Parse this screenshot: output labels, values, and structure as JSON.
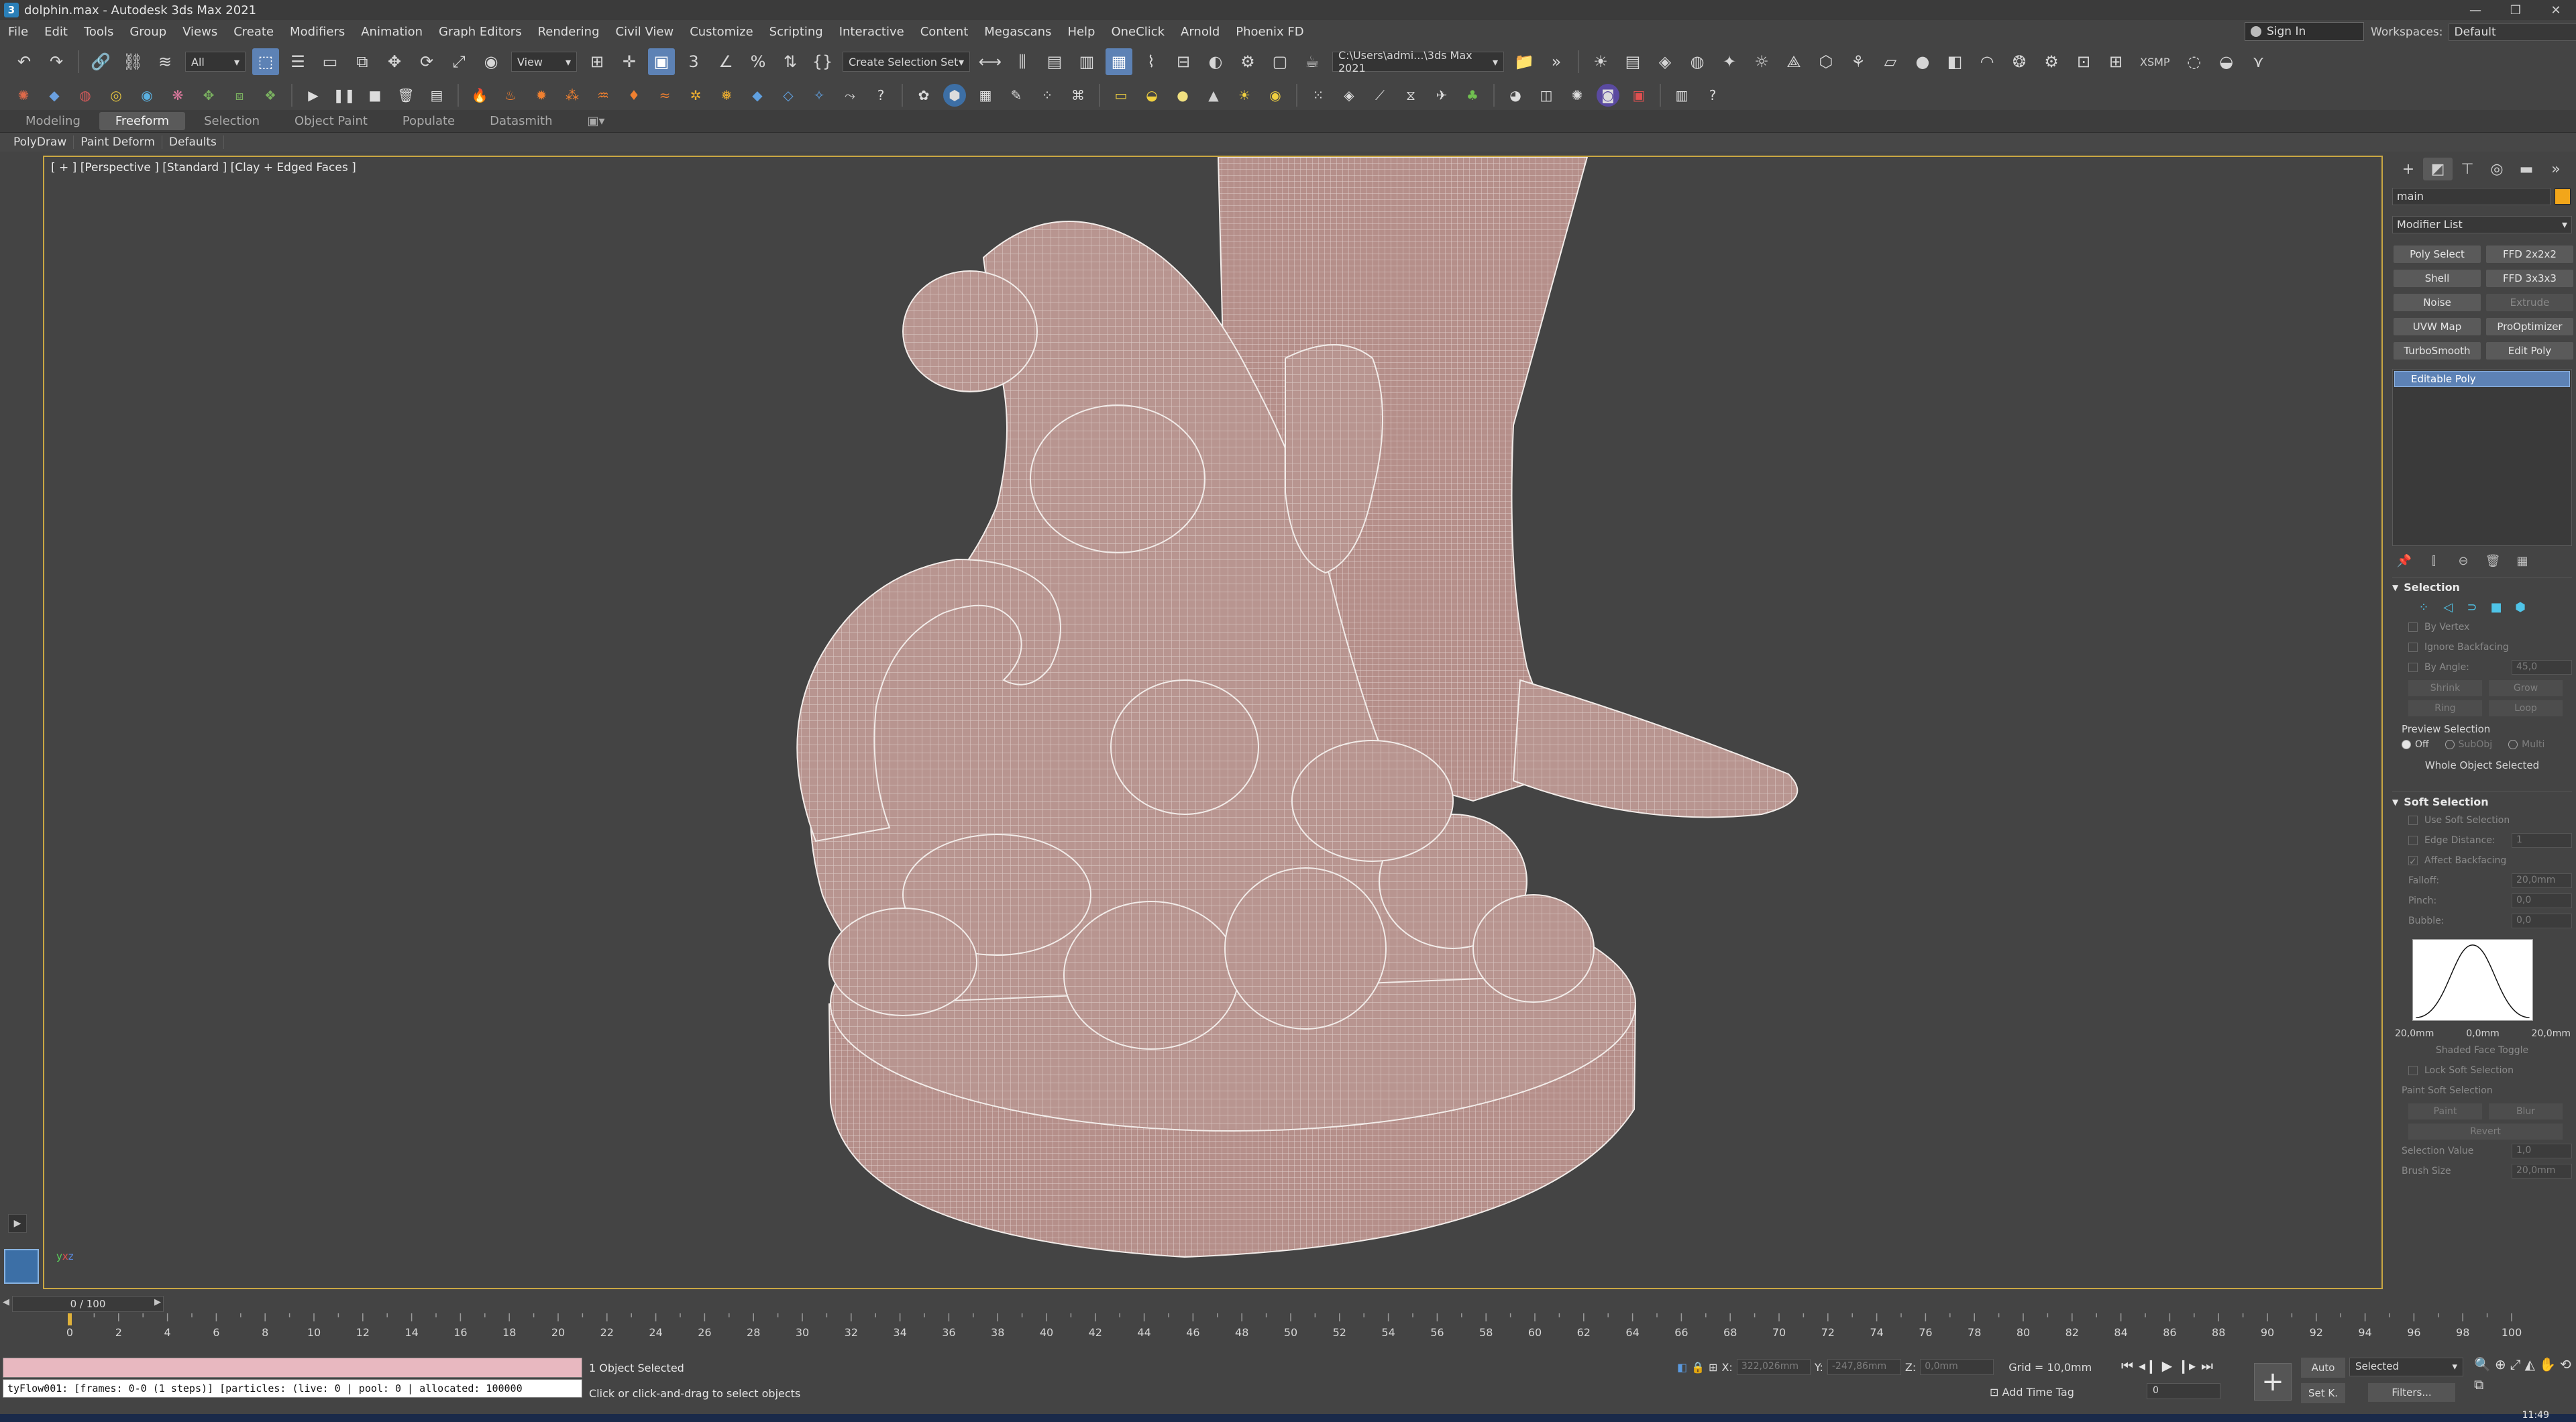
{
  "window": {
    "title": "dolphin.max - Autodesk 3ds Max 2021",
    "controls": [
      "—",
      "❐",
      "✕"
    ]
  },
  "menu": {
    "items": [
      "File",
      "Edit",
      "Tools",
      "Group",
      "Views",
      "Create",
      "Modifiers",
      "Animation",
      "Graph Editors",
      "Rendering",
      "Civil View",
      "Customize",
      "Scripting",
      "Interactive",
      "Content",
      "Megascans",
      "Help",
      "OneClick",
      "Arnold",
      "Phoenix FD"
    ],
    "signin": "Sign In",
    "workspaces_label": "Workspaces:",
    "workspace_value": "Default"
  },
  "toolbar": {
    "filter": "All",
    "view": "View",
    "selection_set": "Create Selection Set",
    "project_path": "C:\\Users\\admi...\\3ds Max 2021",
    "xsmp": "XSMP"
  },
  "ribbon": {
    "tabs": [
      "Modeling",
      "Freeform",
      "Selection",
      "Object Paint",
      "Populate",
      "Datasmith"
    ],
    "active_tab": "Freeform",
    "subtabs": [
      "PolyDraw",
      "Paint Deform",
      "Defaults"
    ]
  },
  "viewport": {
    "label": "[ + ] [Perspective ] [Standard ] [Clay + Edged Faces ]",
    "mesh_color": "#b89590",
    "wire_color": "#f2ece9"
  },
  "command_panel": {
    "object_name": "main",
    "object_color": "#f2a61a",
    "modifier_list": "Modifier List",
    "modifier_buttons": [
      {
        "label": "Poly Select",
        "enabled": true
      },
      {
        "label": "FFD 2x2x2",
        "enabled": true
      },
      {
        "label": "Shell",
        "enabled": true
      },
      {
        "label": "FFD 3x3x3",
        "enabled": true
      },
      {
        "label": "Noise",
        "enabled": true
      },
      {
        "label": "Extrude",
        "enabled": false
      },
      {
        "label": "UVW Map",
        "enabled": true
      },
      {
        "label": "ProOptimizer",
        "enabled": true
      },
      {
        "label": "TurboSmooth",
        "enabled": true
      },
      {
        "label": "Edit Poly",
        "enabled": true
      }
    ],
    "stack": [
      "Editable Poly"
    ],
    "selection": {
      "title": "Selection",
      "by_vertex": "By Vertex",
      "ignore_backfacing": "Ignore Backfacing",
      "by_angle": "By Angle:",
      "by_angle_value": "45,0",
      "shrink": "Shrink",
      "grow": "Grow",
      "ring": "Ring",
      "loop": "Loop",
      "preview_selection": "Preview Selection",
      "preview_off": "Off",
      "preview_subobj": "SubObj",
      "preview_multi": "Multi",
      "whole_object": "Whole Object Selected"
    },
    "soft_selection": {
      "title": "Soft Selection",
      "use_soft": "Use Soft Selection",
      "edge_distance": "Edge Distance:",
      "edge_distance_value": "1",
      "affect_backfacing": "Affect Backfacing",
      "falloff": "Falloff:",
      "falloff_value": "20,0mm",
      "pinch": "Pinch:",
      "pinch_value": "0,0",
      "bubble": "Bubble:",
      "bubble_value": "0,0",
      "curve_left": "20,0mm",
      "curve_mid": "0,0mm",
      "curve_right": "20,0mm",
      "shaded_face_toggle": "Shaded Face Toggle",
      "lock_soft": "Lock Soft Selection",
      "paint_soft": "Paint Soft Selection",
      "paint": "Paint",
      "blur": "Blur",
      "revert": "Revert",
      "selection_value": "Selection Value",
      "selection_value_num": "1,0",
      "brush_size": "Brush Size",
      "brush_size_value": "20,0mm"
    }
  },
  "timeline": {
    "slider": "0 / 100",
    "ticks": [
      "0",
      "2",
      "4",
      "6",
      "8",
      "10",
      "12",
      "14",
      "16",
      "18",
      "20",
      "22",
      "24",
      "26",
      "28",
      "30",
      "32",
      "34",
      "36",
      "38",
      "40",
      "42",
      "44",
      "46",
      "48",
      "50",
      "52",
      "54",
      "56",
      "58",
      "60",
      "62",
      "64",
      "66",
      "68",
      "70",
      "72",
      "74",
      "76",
      "78",
      "80",
      "82",
      "84",
      "86",
      "88",
      "90",
      "92",
      "94",
      "96",
      "98",
      "100"
    ]
  },
  "status": {
    "maxscript_output": "tyFlow001: [frames: 0-0 (1 steps)] [particles: (live: 0 | pool: 0 | allocated: 100000",
    "objects_selected": "1 Object Selected",
    "prompt": "Click or click-and-drag to select objects",
    "x_label": "X:",
    "x_value": "322,026mm",
    "y_label": "Y:",
    "y_value": "-247,86mm",
    "z_label": "Z:",
    "z_value": "0,0mm",
    "grid": "Grid = 10,0mm",
    "add_time_tag": "Add Time Tag",
    "frame": "0",
    "auto": "Auto",
    "setk": "Set K.",
    "selected": "Selected",
    "filters": "Filters...",
    "clock": "11:49"
  }
}
